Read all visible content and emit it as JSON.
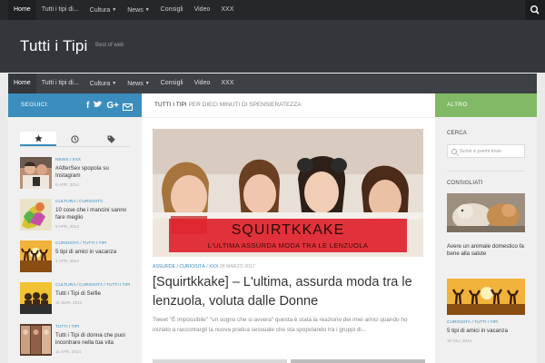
{
  "top_nav": [
    {
      "label": "Home",
      "caret": false
    },
    {
      "label": "Tutti i tipi di...",
      "caret": false
    },
    {
      "label": "Cultura",
      "caret": true
    },
    {
      "label": "News",
      "caret": true
    },
    {
      "label": "Consigli",
      "caret": false
    },
    {
      "label": "Video",
      "caret": false
    },
    {
      "label": "XXX",
      "caret": false
    }
  ],
  "header": {
    "title": "Tutti i Tipi",
    "tagline": "Best of web"
  },
  "main_nav": [
    {
      "label": "Home",
      "caret": false
    },
    {
      "label": "Tutti i tipi di...",
      "caret": false
    },
    {
      "label": "Cultura",
      "caret": true
    },
    {
      "label": "News",
      "caret": true
    },
    {
      "label": "Consigli",
      "caret": false
    },
    {
      "label": "Video",
      "caret": false
    },
    {
      "label": "XXX",
      "caret": false
    }
  ],
  "left_sidebar": {
    "follow_label": "SEGUICI:",
    "posts": [
      {
        "category": "NEWS / XXX",
        "title": "#AfterSex spopola su Instagram",
        "date": "5 APR, 2014",
        "thumb": "photo-couple"
      },
      {
        "category": "CULTURA / CURIOSITÀ",
        "title": "10 cose che i mancini sanno fare meglio",
        "date": "5 APR, 2014",
        "thumb": "photo-knot"
      },
      {
        "category": "CURIOSITÀ / TUTTI I TIPI",
        "title": "5 tipi di amici in vacanza",
        "date": "4 APR, 2014",
        "thumb": "photo-sunset"
      },
      {
        "category": "CULTURA / CURIOSITÀ / TUTTI I TIPI",
        "title": "Tutti i Tipi di Selfie",
        "date": "31 MAR, 2014",
        "thumb": "photo-selfie"
      },
      {
        "category": "TUTTI I TIPI",
        "title": "Tutti i Tipi di donna che puoi incontrare nella tua vita",
        "date": "11 APR, 2014",
        "thumb": "photo-women"
      }
    ]
  },
  "main": {
    "breadcrumb_section": "TUTTI I TIPI",
    "breadcrumb_desc": "PER DIECI MINUTI DI SPENSIERATEZZA",
    "feature": {
      "banner_title": "SQUIRTKKAKE",
      "banner_subtitle": "L'ULTIMA ASSURDA MODA TRA LE LENZUOLA",
      "category_line": "ASSURDE / CURIOSITÀ / XXX",
      "date": "28 MARZO 2017",
      "headline": "[Squirtkkake] – L'ultima, assurda moda tra le lenzuola, voluta dalle Donne",
      "excerpt": "Tweet \"È impossibile\" \"un sogno che si avvera\" questa è stata la reazione dei miei amici quando ho iniziato a raccontargli la nuova pratica sessuale che sta spopolando tra i gruppi di..."
    }
  },
  "right_sidebar": {
    "header_label": "ALTRO",
    "search_heading": "CERCA",
    "search_placeholder": "Scrivi e premi invio",
    "consigli_heading": "CONSIGLIATI",
    "posts": [
      {
        "category": "",
        "title": "Avere un animale domestico fa bene alla salute",
        "date": "",
        "thumb": "photo-dogs"
      },
      {
        "category": "CURIOSITÀ / TUTTI I TIPI",
        "title": "5 tipi di amici in vacanza",
        "date": "10 GIU, 2014",
        "thumb": "photo-sunset"
      }
    ]
  },
  "colors": {
    "accent_blue": "#3b8dbd",
    "accent_green": "#82b965",
    "topbar": "#26272b",
    "header_bg": "#33363b",
    "nav_bg": "#3d4146"
  },
  "icons": {
    "search": "search-icon",
    "social": [
      "facebook-icon",
      "twitter-icon",
      "google-plus-icon",
      "mail-icon"
    ],
    "tabs": [
      "star-icon",
      "clock-icon",
      "tag-icon"
    ]
  }
}
